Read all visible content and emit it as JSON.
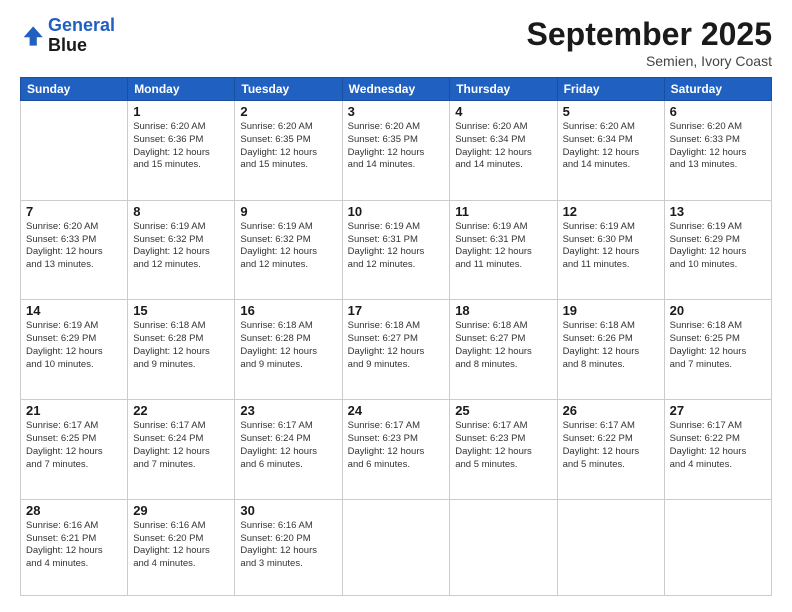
{
  "logo": {
    "line1": "General",
    "line2": "Blue"
  },
  "title": "September 2025",
  "subtitle": "Semien, Ivory Coast",
  "days_header": [
    "Sunday",
    "Monday",
    "Tuesday",
    "Wednesday",
    "Thursday",
    "Friday",
    "Saturday"
  ],
  "weeks": [
    [
      {
        "num": "",
        "info": ""
      },
      {
        "num": "1",
        "info": "Sunrise: 6:20 AM\nSunset: 6:36 PM\nDaylight: 12 hours\nand 15 minutes."
      },
      {
        "num": "2",
        "info": "Sunrise: 6:20 AM\nSunset: 6:35 PM\nDaylight: 12 hours\nand 15 minutes."
      },
      {
        "num": "3",
        "info": "Sunrise: 6:20 AM\nSunset: 6:35 PM\nDaylight: 12 hours\nand 14 minutes."
      },
      {
        "num": "4",
        "info": "Sunrise: 6:20 AM\nSunset: 6:34 PM\nDaylight: 12 hours\nand 14 minutes."
      },
      {
        "num": "5",
        "info": "Sunrise: 6:20 AM\nSunset: 6:34 PM\nDaylight: 12 hours\nand 14 minutes."
      },
      {
        "num": "6",
        "info": "Sunrise: 6:20 AM\nSunset: 6:33 PM\nDaylight: 12 hours\nand 13 minutes."
      }
    ],
    [
      {
        "num": "7",
        "info": "Sunrise: 6:20 AM\nSunset: 6:33 PM\nDaylight: 12 hours\nand 13 minutes."
      },
      {
        "num": "8",
        "info": "Sunrise: 6:19 AM\nSunset: 6:32 PM\nDaylight: 12 hours\nand 12 minutes."
      },
      {
        "num": "9",
        "info": "Sunrise: 6:19 AM\nSunset: 6:32 PM\nDaylight: 12 hours\nand 12 minutes."
      },
      {
        "num": "10",
        "info": "Sunrise: 6:19 AM\nSunset: 6:31 PM\nDaylight: 12 hours\nand 12 minutes."
      },
      {
        "num": "11",
        "info": "Sunrise: 6:19 AM\nSunset: 6:31 PM\nDaylight: 12 hours\nand 11 minutes."
      },
      {
        "num": "12",
        "info": "Sunrise: 6:19 AM\nSunset: 6:30 PM\nDaylight: 12 hours\nand 11 minutes."
      },
      {
        "num": "13",
        "info": "Sunrise: 6:19 AM\nSunset: 6:29 PM\nDaylight: 12 hours\nand 10 minutes."
      }
    ],
    [
      {
        "num": "14",
        "info": "Sunrise: 6:19 AM\nSunset: 6:29 PM\nDaylight: 12 hours\nand 10 minutes."
      },
      {
        "num": "15",
        "info": "Sunrise: 6:18 AM\nSunset: 6:28 PM\nDaylight: 12 hours\nand 9 minutes."
      },
      {
        "num": "16",
        "info": "Sunrise: 6:18 AM\nSunset: 6:28 PM\nDaylight: 12 hours\nand 9 minutes."
      },
      {
        "num": "17",
        "info": "Sunrise: 6:18 AM\nSunset: 6:27 PM\nDaylight: 12 hours\nand 9 minutes."
      },
      {
        "num": "18",
        "info": "Sunrise: 6:18 AM\nSunset: 6:27 PM\nDaylight: 12 hours\nand 8 minutes."
      },
      {
        "num": "19",
        "info": "Sunrise: 6:18 AM\nSunset: 6:26 PM\nDaylight: 12 hours\nand 8 minutes."
      },
      {
        "num": "20",
        "info": "Sunrise: 6:18 AM\nSunset: 6:25 PM\nDaylight: 12 hours\nand 7 minutes."
      }
    ],
    [
      {
        "num": "21",
        "info": "Sunrise: 6:17 AM\nSunset: 6:25 PM\nDaylight: 12 hours\nand 7 minutes."
      },
      {
        "num": "22",
        "info": "Sunrise: 6:17 AM\nSunset: 6:24 PM\nDaylight: 12 hours\nand 7 minutes."
      },
      {
        "num": "23",
        "info": "Sunrise: 6:17 AM\nSunset: 6:24 PM\nDaylight: 12 hours\nand 6 minutes."
      },
      {
        "num": "24",
        "info": "Sunrise: 6:17 AM\nSunset: 6:23 PM\nDaylight: 12 hours\nand 6 minutes."
      },
      {
        "num": "25",
        "info": "Sunrise: 6:17 AM\nSunset: 6:23 PM\nDaylight: 12 hours\nand 5 minutes."
      },
      {
        "num": "26",
        "info": "Sunrise: 6:17 AM\nSunset: 6:22 PM\nDaylight: 12 hours\nand 5 minutes."
      },
      {
        "num": "27",
        "info": "Sunrise: 6:17 AM\nSunset: 6:22 PM\nDaylight: 12 hours\nand 4 minutes."
      }
    ],
    [
      {
        "num": "28",
        "info": "Sunrise: 6:16 AM\nSunset: 6:21 PM\nDaylight: 12 hours\nand 4 minutes."
      },
      {
        "num": "29",
        "info": "Sunrise: 6:16 AM\nSunset: 6:20 PM\nDaylight: 12 hours\nand 4 minutes."
      },
      {
        "num": "30",
        "info": "Sunrise: 6:16 AM\nSunset: 6:20 PM\nDaylight: 12 hours\nand 3 minutes."
      },
      {
        "num": "",
        "info": ""
      },
      {
        "num": "",
        "info": ""
      },
      {
        "num": "",
        "info": ""
      },
      {
        "num": "",
        "info": ""
      }
    ]
  ]
}
